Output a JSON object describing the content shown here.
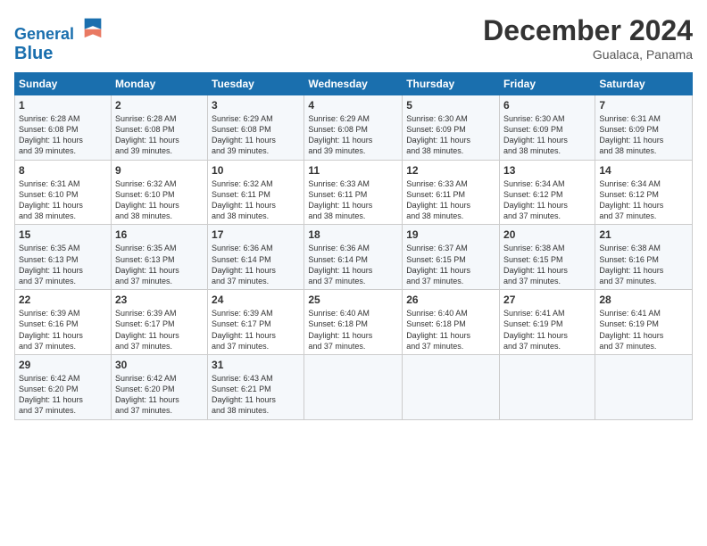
{
  "header": {
    "logo_line1": "General",
    "logo_line2": "Blue",
    "title": "December 2024",
    "subtitle": "Gualaca, Panama"
  },
  "days_of_week": [
    "Sunday",
    "Monday",
    "Tuesday",
    "Wednesday",
    "Thursday",
    "Friday",
    "Saturday"
  ],
  "weeks": [
    [
      {
        "day": "1",
        "info": "Sunrise: 6:28 AM\nSunset: 6:08 PM\nDaylight: 11 hours\nand 39 minutes."
      },
      {
        "day": "2",
        "info": "Sunrise: 6:28 AM\nSunset: 6:08 PM\nDaylight: 11 hours\nand 39 minutes."
      },
      {
        "day": "3",
        "info": "Sunrise: 6:29 AM\nSunset: 6:08 PM\nDaylight: 11 hours\nand 39 minutes."
      },
      {
        "day": "4",
        "info": "Sunrise: 6:29 AM\nSunset: 6:08 PM\nDaylight: 11 hours\nand 39 minutes."
      },
      {
        "day": "5",
        "info": "Sunrise: 6:30 AM\nSunset: 6:09 PM\nDaylight: 11 hours\nand 38 minutes."
      },
      {
        "day": "6",
        "info": "Sunrise: 6:30 AM\nSunset: 6:09 PM\nDaylight: 11 hours\nand 38 minutes."
      },
      {
        "day": "7",
        "info": "Sunrise: 6:31 AM\nSunset: 6:09 PM\nDaylight: 11 hours\nand 38 minutes."
      }
    ],
    [
      {
        "day": "8",
        "info": "Sunrise: 6:31 AM\nSunset: 6:10 PM\nDaylight: 11 hours\nand 38 minutes."
      },
      {
        "day": "9",
        "info": "Sunrise: 6:32 AM\nSunset: 6:10 PM\nDaylight: 11 hours\nand 38 minutes."
      },
      {
        "day": "10",
        "info": "Sunrise: 6:32 AM\nSunset: 6:11 PM\nDaylight: 11 hours\nand 38 minutes."
      },
      {
        "day": "11",
        "info": "Sunrise: 6:33 AM\nSunset: 6:11 PM\nDaylight: 11 hours\nand 38 minutes."
      },
      {
        "day": "12",
        "info": "Sunrise: 6:33 AM\nSunset: 6:11 PM\nDaylight: 11 hours\nand 38 minutes."
      },
      {
        "day": "13",
        "info": "Sunrise: 6:34 AM\nSunset: 6:12 PM\nDaylight: 11 hours\nand 37 minutes."
      },
      {
        "day": "14",
        "info": "Sunrise: 6:34 AM\nSunset: 6:12 PM\nDaylight: 11 hours\nand 37 minutes."
      }
    ],
    [
      {
        "day": "15",
        "info": "Sunrise: 6:35 AM\nSunset: 6:13 PM\nDaylight: 11 hours\nand 37 minutes."
      },
      {
        "day": "16",
        "info": "Sunrise: 6:35 AM\nSunset: 6:13 PM\nDaylight: 11 hours\nand 37 minutes."
      },
      {
        "day": "17",
        "info": "Sunrise: 6:36 AM\nSunset: 6:14 PM\nDaylight: 11 hours\nand 37 minutes."
      },
      {
        "day": "18",
        "info": "Sunrise: 6:36 AM\nSunset: 6:14 PM\nDaylight: 11 hours\nand 37 minutes."
      },
      {
        "day": "19",
        "info": "Sunrise: 6:37 AM\nSunset: 6:15 PM\nDaylight: 11 hours\nand 37 minutes."
      },
      {
        "day": "20",
        "info": "Sunrise: 6:38 AM\nSunset: 6:15 PM\nDaylight: 11 hours\nand 37 minutes."
      },
      {
        "day": "21",
        "info": "Sunrise: 6:38 AM\nSunset: 6:16 PM\nDaylight: 11 hours\nand 37 minutes."
      }
    ],
    [
      {
        "day": "22",
        "info": "Sunrise: 6:39 AM\nSunset: 6:16 PM\nDaylight: 11 hours\nand 37 minutes."
      },
      {
        "day": "23",
        "info": "Sunrise: 6:39 AM\nSunset: 6:17 PM\nDaylight: 11 hours\nand 37 minutes."
      },
      {
        "day": "24",
        "info": "Sunrise: 6:39 AM\nSunset: 6:17 PM\nDaylight: 11 hours\nand 37 minutes."
      },
      {
        "day": "25",
        "info": "Sunrise: 6:40 AM\nSunset: 6:18 PM\nDaylight: 11 hours\nand 37 minutes."
      },
      {
        "day": "26",
        "info": "Sunrise: 6:40 AM\nSunset: 6:18 PM\nDaylight: 11 hours\nand 37 minutes."
      },
      {
        "day": "27",
        "info": "Sunrise: 6:41 AM\nSunset: 6:19 PM\nDaylight: 11 hours\nand 37 minutes."
      },
      {
        "day": "28",
        "info": "Sunrise: 6:41 AM\nSunset: 6:19 PM\nDaylight: 11 hours\nand 37 minutes."
      }
    ],
    [
      {
        "day": "29",
        "info": "Sunrise: 6:42 AM\nSunset: 6:20 PM\nDaylight: 11 hours\nand 37 minutes."
      },
      {
        "day": "30",
        "info": "Sunrise: 6:42 AM\nSunset: 6:20 PM\nDaylight: 11 hours\nand 37 minutes."
      },
      {
        "day": "31",
        "info": "Sunrise: 6:43 AM\nSunset: 6:21 PM\nDaylight: 11 hours\nand 38 minutes."
      },
      {
        "day": "",
        "info": ""
      },
      {
        "day": "",
        "info": ""
      },
      {
        "day": "",
        "info": ""
      },
      {
        "day": "",
        "info": ""
      }
    ]
  ]
}
